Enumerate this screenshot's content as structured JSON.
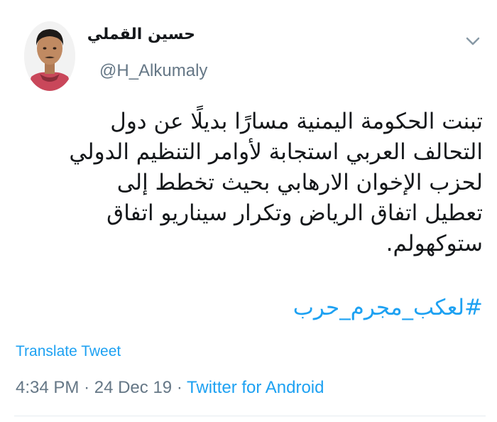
{
  "tweet": {
    "author_name": "حسين القملي",
    "author_handle": "@H_Alkumaly",
    "body_lines": [
      "تبنت الحكومة اليمنية مسارًا بديلًا عن دول",
      "التحالف العربي استجابة لأوامر التنظيم الدولي",
      "لحزب الإخوان الارهابي بحيث تخطط إلى",
      "تعطيل اتفاق الرياض وتكرار سيناريو اتفاق",
      "ستوكهولم."
    ],
    "hashtag": "#لعكب_مجرم_حرب",
    "translate_label": "Translate Tweet",
    "time": "4:34 PM",
    "date": "24 Dec 19",
    "source": "Twitter for Android",
    "separator": "·"
  },
  "icons": {
    "caret": "chevron-down-icon",
    "avatar": "avatar"
  },
  "colors": {
    "link": "#1da1f2",
    "muted": "#657786",
    "text": "#14171a",
    "divider": "#e6ecf0"
  }
}
